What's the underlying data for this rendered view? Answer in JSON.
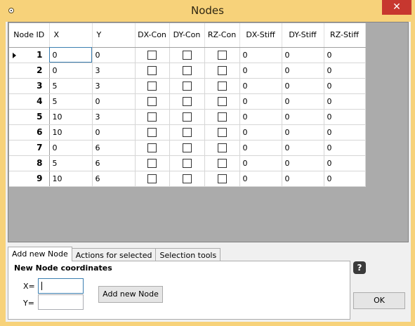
{
  "window": {
    "title": "Nodes",
    "close_glyph": "✕",
    "app_icon": "circle-dot-icon"
  },
  "grid": {
    "headers": [
      "Node ID",
      "X",
      "Y",
      "DX-Con",
      "DY-Con",
      "RZ-Con",
      "DX-Stiff",
      "DY-Stiff",
      "RZ-Stiff"
    ],
    "current_row": 1,
    "rows": [
      {
        "id": "1",
        "x": "0",
        "y": "0",
        "dx_con": false,
        "dy_con": false,
        "rz_con": false,
        "dx_stiff": "0",
        "dy_stiff": "0",
        "rz_stiff": "0"
      },
      {
        "id": "2",
        "x": "0",
        "y": "3",
        "dx_con": false,
        "dy_con": false,
        "rz_con": false,
        "dx_stiff": "0",
        "dy_stiff": "0",
        "rz_stiff": "0"
      },
      {
        "id": "3",
        "x": "5",
        "y": "3",
        "dx_con": false,
        "dy_con": false,
        "rz_con": false,
        "dx_stiff": "0",
        "dy_stiff": "0",
        "rz_stiff": "0"
      },
      {
        "id": "4",
        "x": "5",
        "y": "0",
        "dx_con": false,
        "dy_con": false,
        "rz_con": false,
        "dx_stiff": "0",
        "dy_stiff": "0",
        "rz_stiff": "0"
      },
      {
        "id": "5",
        "x": "10",
        "y": "3",
        "dx_con": false,
        "dy_con": false,
        "rz_con": false,
        "dx_stiff": "0",
        "dy_stiff": "0",
        "rz_stiff": "0"
      },
      {
        "id": "6",
        "x": "10",
        "y": "0",
        "dx_con": false,
        "dy_con": false,
        "rz_con": false,
        "dx_stiff": "0",
        "dy_stiff": "0",
        "rz_stiff": "0"
      },
      {
        "id": "7",
        "x": "0",
        "y": "6",
        "dx_con": false,
        "dy_con": false,
        "rz_con": false,
        "dx_stiff": "0",
        "dy_stiff": "0",
        "rz_stiff": "0"
      },
      {
        "id": "8",
        "x": "5",
        "y": "6",
        "dx_con": false,
        "dy_con": false,
        "rz_con": false,
        "dx_stiff": "0",
        "dy_stiff": "0",
        "rz_stiff": "0"
      },
      {
        "id": "9",
        "x": "10",
        "y": "6",
        "dx_con": false,
        "dy_con": false,
        "rz_con": false,
        "dx_stiff": "0",
        "dy_stiff": "0",
        "rz_stiff": "0"
      }
    ]
  },
  "tabs": [
    {
      "label": "Add new Node",
      "active": true
    },
    {
      "label": "Actions for selected",
      "active": false
    },
    {
      "label": "Selection tools",
      "active": false
    }
  ],
  "panel": {
    "title": "New Node coordinates",
    "x_label": "X=",
    "y_label": "Y=",
    "x_value": "",
    "y_value": "",
    "add_button": "Add new Node"
  },
  "help_glyph": "?",
  "ok_button": "OK",
  "colors": {
    "titlebar": "#f7d27a",
    "close": "#c7372f",
    "grid_background": "#ababab"
  }
}
